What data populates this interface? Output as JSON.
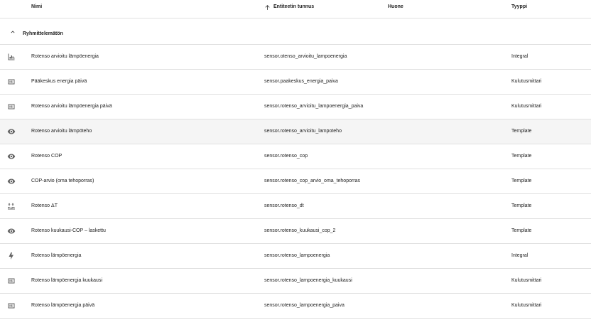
{
  "header": {
    "name": "Nimi",
    "entity_id": "Entiteetin tunnus",
    "area": "Huone",
    "type": "Tyyppi"
  },
  "group": {
    "label": "Ryhmittelemätön"
  },
  "rows": [
    {
      "icon": "chart-bars-icon",
      "name": "Rotenso arvioitu lämpöenergia",
      "entity_id": "sensor.otenso_arvioitu_lampoenergia",
      "type": "Integral"
    },
    {
      "icon": "counter-icon",
      "name": "Pääkeskus energia päivä",
      "entity_id": "sensor.paakeskus_energia_paiva",
      "type": "Kulutusmittari"
    },
    {
      "icon": "counter-icon",
      "name": "Rotenso arvioitu lämpöenergia päivä",
      "entity_id": "sensor.rotenso_arvioitu_lampoenergia_paiva",
      "type": "Kulutusmittari"
    },
    {
      "icon": "eye-icon",
      "name": "Rotenso arvioitu lämpöteho",
      "entity_id": "sensor.rotenso_arvioitu_lampoteho",
      "type": "Template"
    },
    {
      "icon": "eye-icon",
      "name": "Rotenso COP",
      "entity_id": "sensor.rotenso_cop",
      "type": "Template"
    },
    {
      "icon": "eye-icon",
      "name": "COP-arvio (oma tehoporras)",
      "entity_id": "sensor.rotenso_cop_arvio_oma_tehoporras",
      "type": "Template"
    },
    {
      "icon": "thermometer-delta-icon",
      "name": "Rotenso ΔT",
      "entity_id": "sensor.rotenso_dt",
      "type": "Template"
    },
    {
      "icon": "eye-icon",
      "name": "Rotenso kuukausi-COP – laskettu",
      "entity_id": "sensor.rotenso_kuukausi_cop_2",
      "type": "Template"
    },
    {
      "icon": "lightning-icon",
      "name": "Rotenso lämpöenergia",
      "entity_id": "sensor.rotenso_lampoenergia",
      "type": "Integral"
    },
    {
      "icon": "counter-icon",
      "name": "Rotenso lämpöenergia kuukausi",
      "entity_id": "sensor.rotenso_lampoenergia_kuukausi",
      "type": "Kulutusmittari"
    },
    {
      "icon": "counter-icon",
      "name": "Rotenso lämpöenergia päivä",
      "entity_id": "sensor.rotenso_lampoenergia_paiva",
      "type": "Kulutusmittari"
    }
  ]
}
